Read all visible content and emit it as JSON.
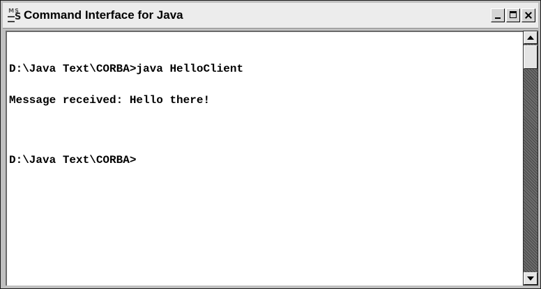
{
  "window": {
    "title": "Command Interface for Java",
    "icon": "ms-dos-icon",
    "controls": [
      "minimize-icon",
      "maximize-icon",
      "close-icon"
    ]
  },
  "console": {
    "lines": [
      "D:\\Java Text\\CORBA>java HelloClient",
      "Message received: Hello there!",
      "",
      "D:\\Java Text\\CORBA>"
    ]
  },
  "scrollbar": {
    "position": 0
  },
  "colors": {
    "console_background": "#ffffff",
    "console_text": "#000000",
    "titlebar_background": "#ececec"
  }
}
